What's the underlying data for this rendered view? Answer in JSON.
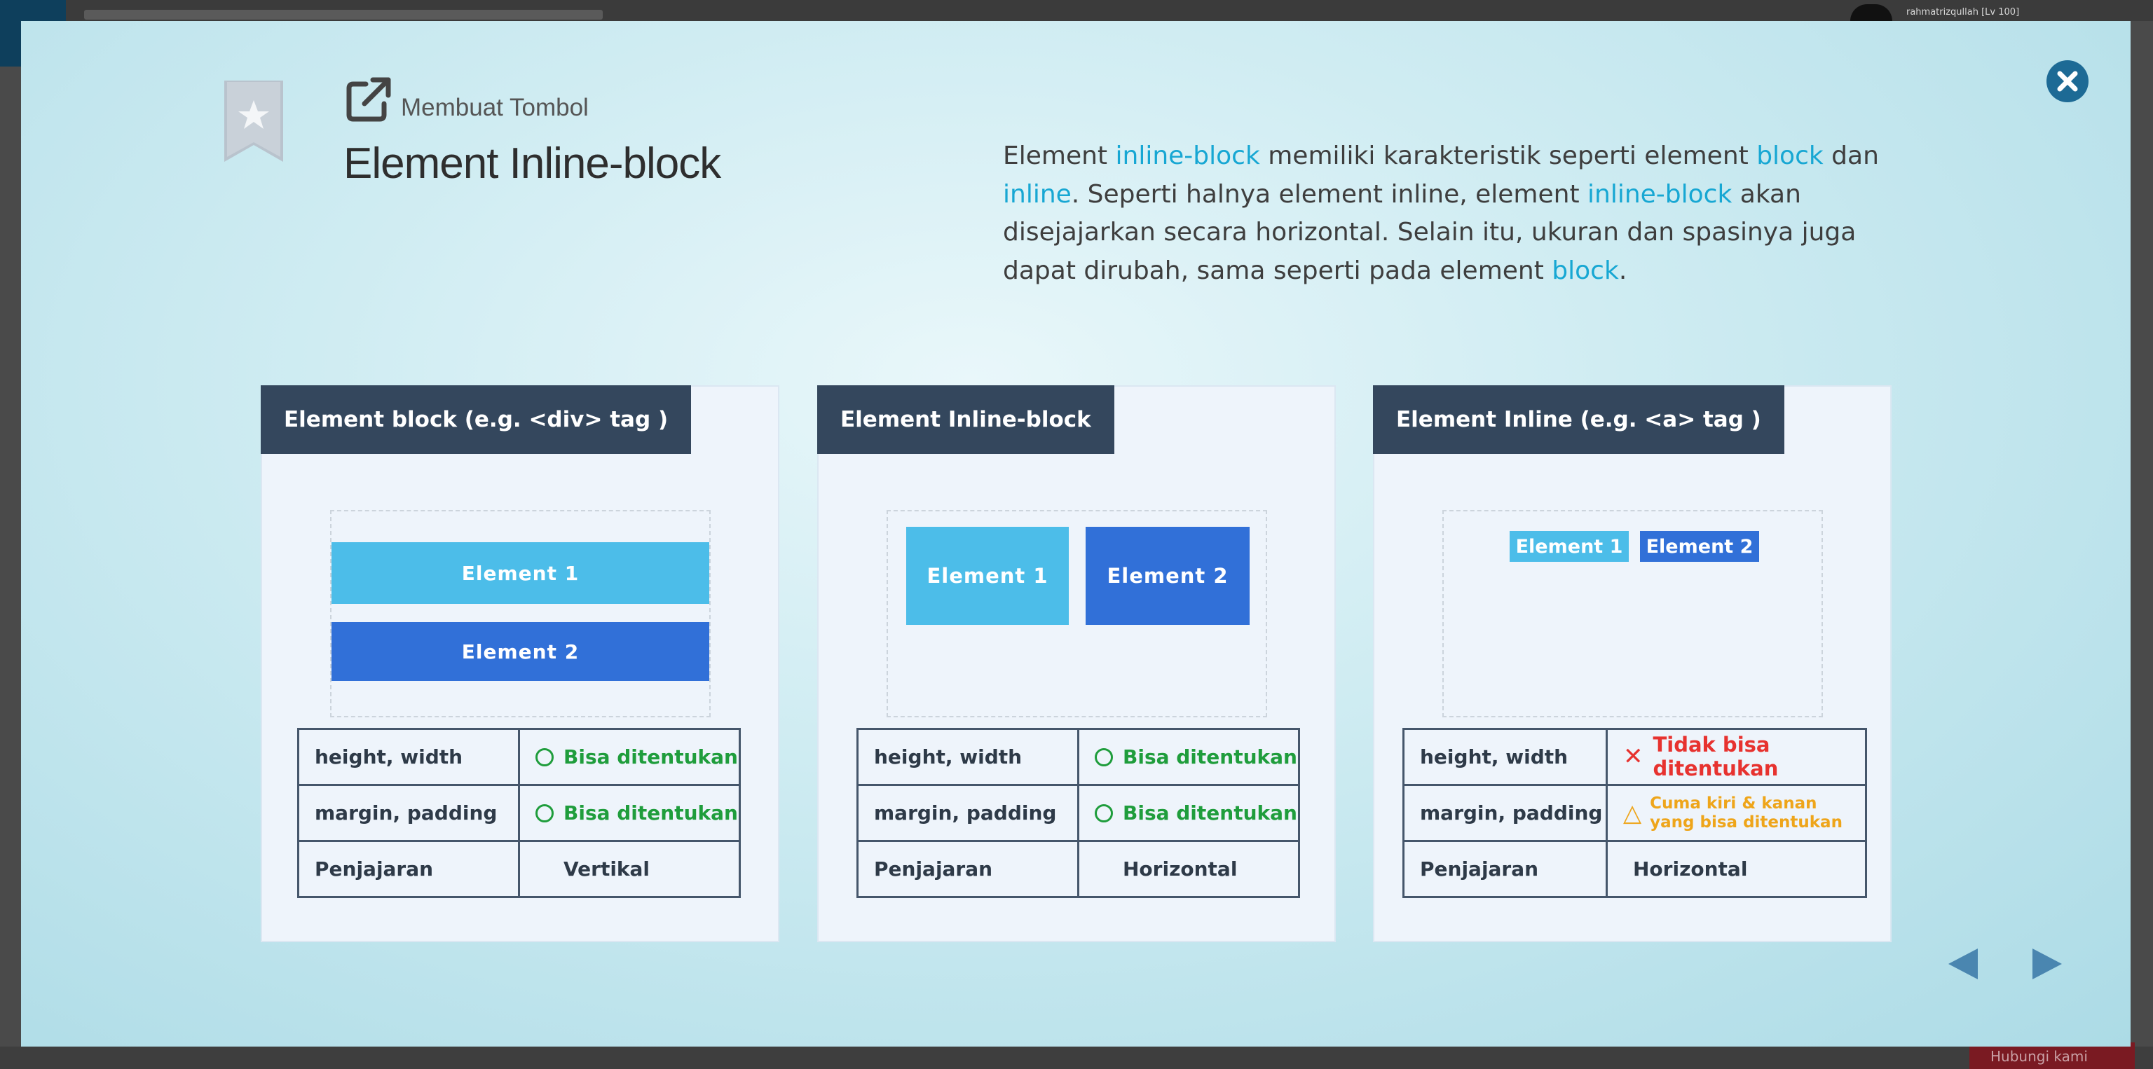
{
  "background": {
    "user_label": "rahmatrizqullah [Lv 100]",
    "feedback_label": "Hubungi kami"
  },
  "modal": {
    "subtitle": "Membuat Tombol",
    "title": "Element Inline-block",
    "description_parts": [
      "Element ",
      "inline-block",
      " memiliki karakteristik seperti element ",
      "block",
      " dan ",
      "inline",
      ". Seperti halnya element inline, element ",
      "inline-block",
      " akan disejajarkan secara horizontal. Selain itu, ukuran dan spasinya juga dapat dirubah, sama seperti pada element ",
      "block",
      "."
    ]
  },
  "panels": [
    {
      "header": "Element block (e.g. <div> tag )",
      "elements": [
        "Element 1",
        "Element 2"
      ],
      "rows": [
        {
          "label": "height, width",
          "value": "Bisa ditentukan"
        },
        {
          "label": "margin, padding",
          "value": "Bisa ditentukan"
        },
        {
          "label": "Penjajaran",
          "value": "Vertikal"
        }
      ]
    },
    {
      "header": "Element Inline-block",
      "elements": [
        "Element 1",
        "Element 2"
      ],
      "rows": [
        {
          "label": "height, width",
          "value": "Bisa ditentukan"
        },
        {
          "label": "margin, padding",
          "value": "Bisa ditentukan"
        },
        {
          "label": "Penjajaran",
          "value": "Horizontal"
        }
      ]
    },
    {
      "header": "Element Inline (e.g. <a> tag )",
      "elements": [
        "Element 1",
        "Element 2"
      ],
      "rows": [
        {
          "label": "height, width",
          "value_line1": "Tidak bisa",
          "value_line2": "ditentukan"
        },
        {
          "label": "margin, padding",
          "value_line1": "Cuma kiri & kanan",
          "value_line2": "yang bisa ditentukan"
        },
        {
          "label": "Penjajaran",
          "value": "Horizontal"
        }
      ]
    }
  ],
  "icons": {
    "bookmark": "star-bookmark-icon",
    "external": "external-link-icon",
    "close": "close-icon",
    "prev": "prev-arrow-icon",
    "next": "next-arrow-icon"
  },
  "colors": {
    "highlight": "#17a7d3",
    "header": "#34475d",
    "element_light": "#4cbde9",
    "element_dark": "#3170d8",
    "ok": "#1f9d3c",
    "bad": "#e7322f",
    "warn": "#eea51a",
    "close": "#1d6a95",
    "nav_arrow": "#4a86b0"
  }
}
